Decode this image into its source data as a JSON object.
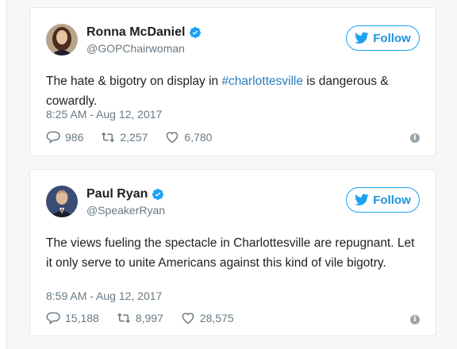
{
  "tweets": [
    {
      "name": "Ronna McDaniel",
      "handle": "@GOPChairwoman",
      "follow_label": "Follow",
      "text_before": "The hate & bigotry on display in ",
      "hashtag": "#charlottesville",
      "text_after": " is dangerous & cowardly.",
      "time": "8:25 AM - Aug 12, 2017",
      "replies": "986",
      "retweets": "2,257",
      "likes": "6,780"
    },
    {
      "name": "Paul Ryan",
      "handle": "@SpeakerRyan",
      "follow_label": "Follow",
      "text": "The views fueling the spectacle in Charlottesville are repugnant. Let it only serve to unite Americans against this kind of vile bigotry.",
      "time": "8:59 AM - Aug 12, 2017",
      "replies": "15,188",
      "retweets": "8,997",
      "likes": "28,575"
    }
  ],
  "icons": {
    "verified": "verified-badge-icon",
    "bird": "twitter-bird-icon",
    "reply": "reply-icon",
    "retweet": "retweet-icon",
    "like": "heart-icon",
    "info": "info-icon"
  },
  "colors": {
    "accent": "#1da1f2",
    "link": "#2b7bb9",
    "muted": "#697882"
  }
}
